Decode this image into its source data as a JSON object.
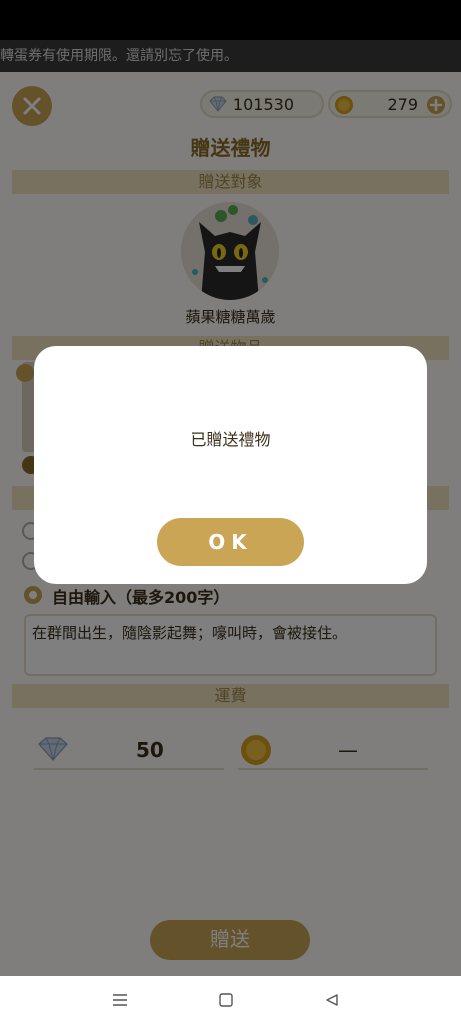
{
  "notice": {
    "text": "轉蛋券有使用期限。還請別忘了使用。"
  },
  "currency": {
    "diamonds": "101530",
    "coins": "279"
  },
  "page": {
    "title": "贈送禮物",
    "recipient_header": "贈送對象",
    "gift_header_partial": "贈送物品",
    "recipient_name": "蘋果糖糖萬歲"
  },
  "message": {
    "free_input_label": "自由輸入（最多200字）",
    "text": "在群間出生，隨陰影起舞；嚎叫時，會被接住。"
  },
  "fee": {
    "header": "運費",
    "diamond_cost": "50",
    "coin_cost": "—"
  },
  "send_button_label": "贈送",
  "dialog": {
    "message": "已贈送禮物",
    "ok_label": "OK"
  },
  "icons": {
    "close": "close-icon",
    "diamond": "diamond-icon",
    "coin": "coin-icon",
    "plus": "plus-icon",
    "nav_menu": "menu-icon",
    "nav_home": "home-square-icon",
    "nav_back": "back-triangle-icon"
  },
  "colors": {
    "accent": "#c9a555",
    "title": "#8a6a26",
    "section_header_bg": "#f0e2c0"
  }
}
